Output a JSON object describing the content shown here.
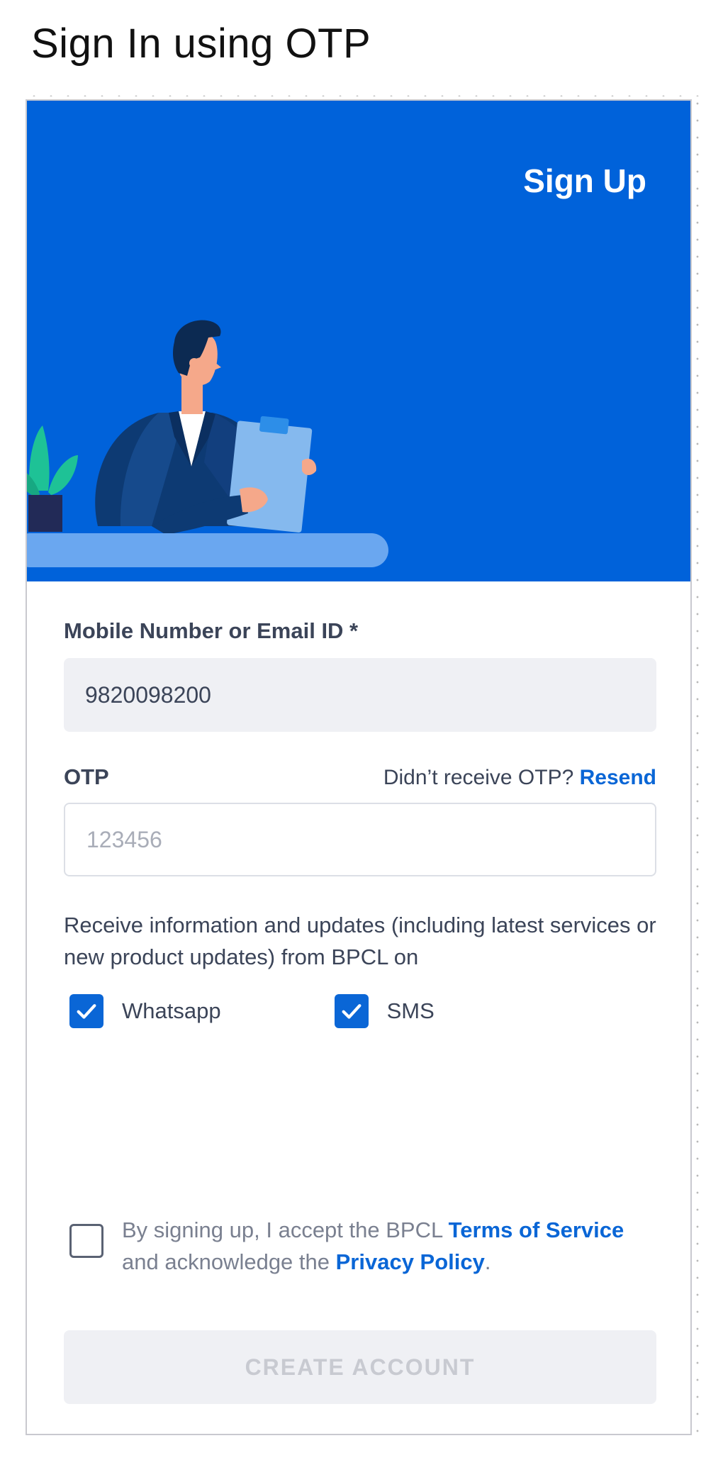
{
  "document": {
    "title": "Sign In using OTP"
  },
  "hero": {
    "title": "Sign Up"
  },
  "form": {
    "mobile_label": "Mobile Number or Email ID *",
    "mobile_value": "9820098200",
    "otp_label": "OTP",
    "resend_prompt": "Didn’t receive OTP?",
    "resend_link": "Resend",
    "otp_placeholder": "123456",
    "consent_text": "Receive information and updates (including latest services or new product updates) from BPCL on",
    "channels": [
      {
        "label": "Whatsapp",
        "checked": true
      },
      {
        "label": "SMS",
        "checked": true
      }
    ]
  },
  "terms": {
    "checked": false,
    "prefix": "By signing up, I accept the BPCL ",
    "tos_link": "Terms of Service",
    "middle": " and acknowledge the ",
    "privacy_link": "Privacy Policy",
    "suffix": "."
  },
  "actions": {
    "create_account": "CREATE ACCOUNT"
  },
  "colors": {
    "brand_blue": "#0062da",
    "link_blue": "#0a66d6",
    "input_bg": "#eff0f4",
    "text": "#3b4458"
  },
  "icons": {
    "checkbox_checked": "check-icon",
    "illustration": "man-with-clipboard-illustration"
  }
}
